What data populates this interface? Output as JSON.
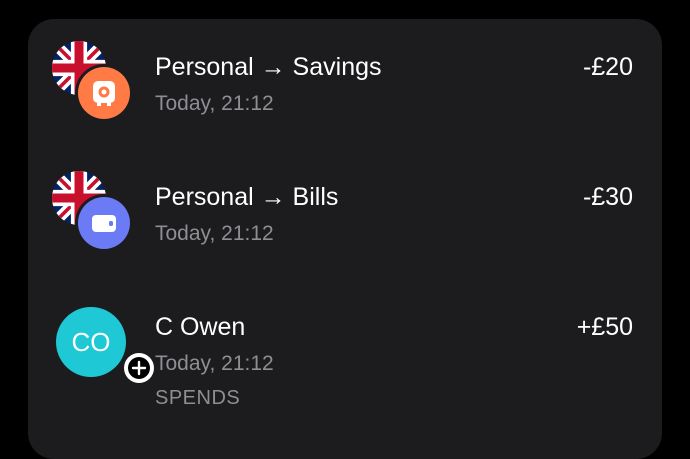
{
  "transactions": [
    {
      "title": "Personal → Savings",
      "time": "Today, 21:12",
      "amount": "-£20",
      "flag_icon": "uk-flag-icon",
      "pocket_icon": "safe-icon",
      "pocket_color": "#ff7a45"
    },
    {
      "title": "Personal → Bills",
      "time": "Today, 21:12",
      "amount": "-£30",
      "flag_icon": "uk-flag-icon",
      "pocket_icon": "wallet-icon",
      "pocket_color": "#6b7bf5"
    },
    {
      "title": "C Owen",
      "time": "Today, 21:12",
      "tag": "SPENDS",
      "amount": "+£50",
      "initials": "CO",
      "initials_color": "#1ec8d4",
      "badge_icon": "plus-icon"
    }
  ],
  "colors": {
    "background": "#000000",
    "card": "#1c1c1e",
    "primary_text": "#ffffff",
    "secondary_text": "#8e8e93"
  }
}
